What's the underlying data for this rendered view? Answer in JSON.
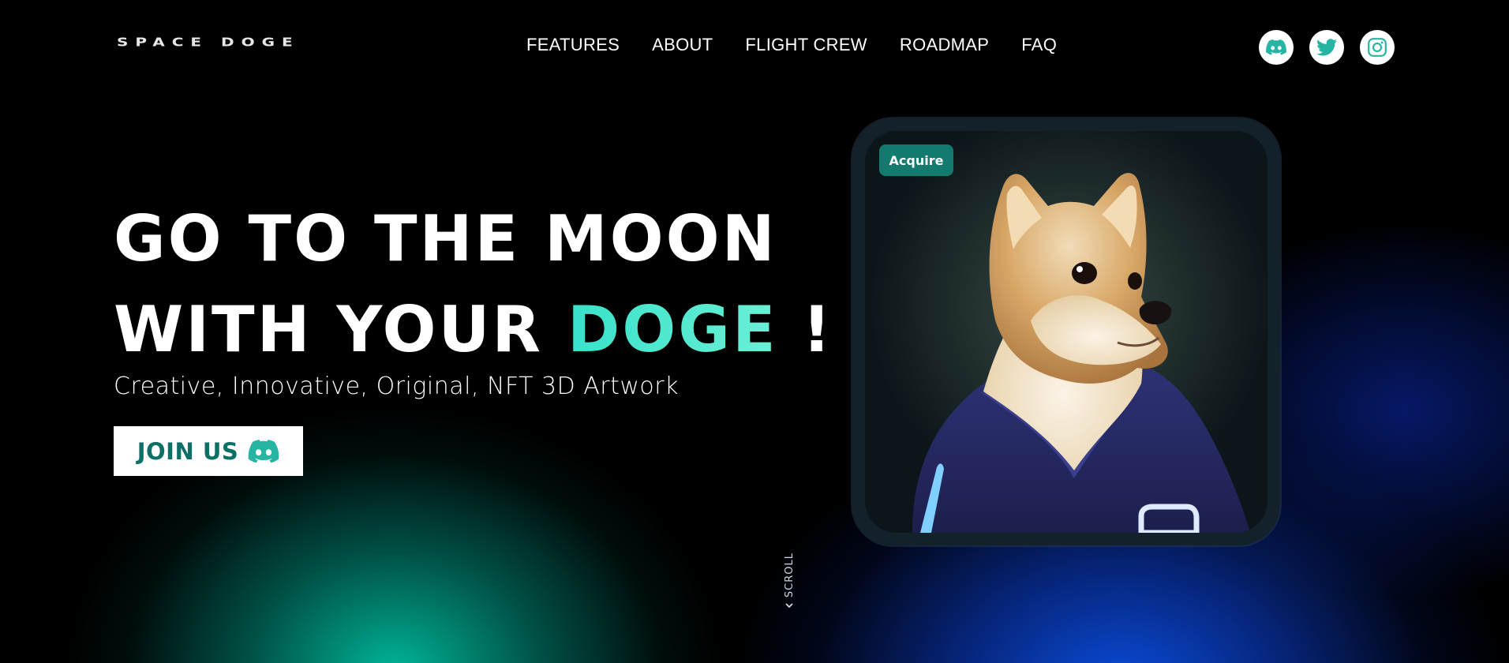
{
  "brand": {
    "logo_text": "SPACE DOGE"
  },
  "nav": {
    "items": [
      {
        "label": "FEATURES"
      },
      {
        "label": "ABOUT"
      },
      {
        "label": "FLIGHT CREW"
      },
      {
        "label": "ROADMAP"
      },
      {
        "label": "FAQ"
      }
    ]
  },
  "socials": [
    {
      "icon": "discord-icon"
    },
    {
      "icon": "twitter-icon"
    },
    {
      "icon": "instagram-icon"
    }
  ],
  "hero": {
    "headline_line1": "GO TO THE MOON",
    "headline_line2_prefix": "WITH YOUR ",
    "headline_accent": "DOGE",
    "headline_suffix": " !",
    "tagline": "Creative, Innovative, Original, NFT 3D Artwork",
    "cta_label": "JOIN US",
    "cta_icon": "discord-icon"
  },
  "card": {
    "badge_label": "Acquire",
    "image": "shiba-doge-hoodie-illustration"
  },
  "scroll": {
    "label": "SCROLL",
    "icon": "chevron-down-icon"
  },
  "colors": {
    "accent": "#4de8cf",
    "teal_button": "#127a6e",
    "cta_text": "#0e6f66",
    "social_icon": "#27b5a3"
  }
}
